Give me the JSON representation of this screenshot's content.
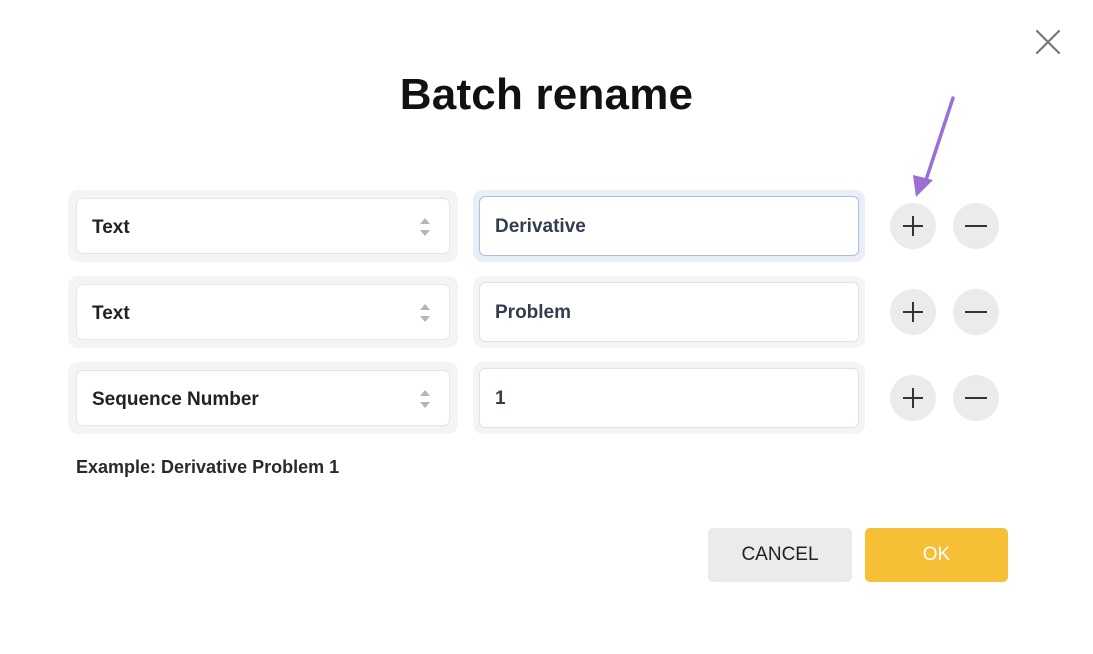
{
  "dialog": {
    "title": "Batch rename",
    "close_icon": "close-icon",
    "rows": [
      {
        "type": "Text",
        "value": "Derivative",
        "focused": true
      },
      {
        "type": "Text",
        "value": "Problem",
        "focused": false
      },
      {
        "type": "Sequence Number",
        "value": "1",
        "focused": false
      }
    ],
    "example": "Example: Derivative Problem 1",
    "cancel_label": "CANCEL",
    "ok_label": "OK"
  },
  "colors": {
    "ok_button": "#f7bf36",
    "annotation_arrow": "#9b6fd6",
    "focus_border": "#a9bde6"
  },
  "annotation": {
    "icon": "arrow-icon",
    "points_to": "add-row-button"
  }
}
